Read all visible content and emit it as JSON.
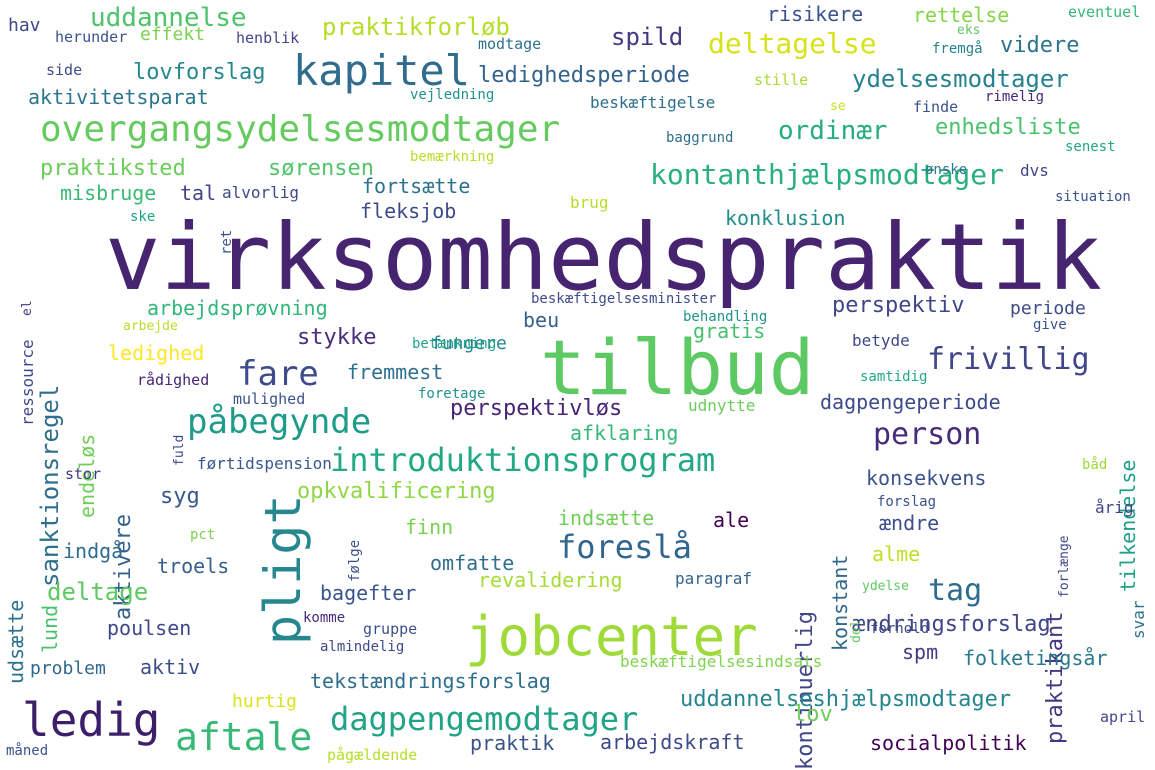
{
  "words": [
    {
      "text": "virksomhedspraktik",
      "color": "#46246f"
    },
    {
      "text": "tilbud",
      "color": "#5dc963"
    },
    {
      "text": "jobcenter",
      "color": "#a0da39"
    },
    {
      "text": "pligt",
      "color": "#26888e"
    },
    {
      "text": "ledig",
      "color": "#3b1f6a"
    },
    {
      "text": "kapitel",
      "color": "#2f6c8e"
    },
    {
      "text": "overgangsydelsesmodtager",
      "color": "#65cb5e"
    },
    {
      "text": "introduktionsprogram",
      "color": "#22a884"
    },
    {
      "text": "aftale",
      "color": "#38b977"
    },
    {
      "text": "påbegynde",
      "color": "#1e9c89"
    },
    {
      "text": "person",
      "color": "#472a7a"
    },
    {
      "text": "foreslå",
      "color": "#31668e"
    },
    {
      "text": "dagpengemodtager",
      "color": "#20a386"
    },
    {
      "text": "fare",
      "color": "#3e4c8a"
    },
    {
      "text": "kontanthjælpsmodtager",
      "color": "#2aaf7f"
    },
    {
      "text": "frivillig",
      "color": "#404688"
    },
    {
      "text": "tag",
      "color": "#2f6b8e"
    },
    {
      "text": "deltagelse",
      "color": "#d8e219"
    },
    {
      "text": "uddannelse",
      "color": "#4ec36b"
    },
    {
      "text": "praktikforløb",
      "color": "#b5de2b"
    },
    {
      "text": "ledighedsperiode",
      "color": "#33628d"
    },
    {
      "text": "ordinær",
      "color": "#27ad81"
    },
    {
      "text": "ydelsesmodtager",
      "color": "#26828e"
    },
    {
      "text": "enhedsliste",
      "color": "#4ac16d"
    },
    {
      "text": "lovforslag",
      "color": "#23898e"
    },
    {
      "text": "aktivitetsparat",
      "color": "#2a768e"
    },
    {
      "text": "praktiksted",
      "color": "#6ccd5a"
    },
    {
      "text": "sørensen",
      "color": "#52c569"
    },
    {
      "text": "misbruge",
      "color": "#3aba76"
    },
    {
      "text": "tal",
      "color": "#414487"
    },
    {
      "text": "spild",
      "color": "#443983"
    },
    {
      "text": "risikere",
      "color": "#3b528b"
    },
    {
      "text": "rettelse",
      "color": "#86d549"
    },
    {
      "text": "videre",
      "color": "#2b748e"
    },
    {
      "text": "fortsætte",
      "color": "#2c728e"
    },
    {
      "text": "fleksjob",
      "color": "#3e4989"
    },
    {
      "text": "konklusion",
      "color": "#228d8d"
    },
    {
      "text": "sanktionsregel",
      "color": "#2e6f8e"
    },
    {
      "text": "arbejdsprøvning",
      "color": "#32b67a"
    },
    {
      "text": "perspektiv",
      "color": "#404688"
    },
    {
      "text": "stykke",
      "color": "#472d7b"
    },
    {
      "text": "beu",
      "color": "#35608d"
    },
    {
      "text": "fungere",
      "color": "#26838f"
    },
    {
      "text": "gratis",
      "color": "#44bf70"
    },
    {
      "text": "ledighed",
      "color": "#fde725"
    },
    {
      "text": "fremmest",
      "color": "#2d708e"
    },
    {
      "text": "perspektivløs",
      "color": "#482475"
    },
    {
      "text": "afklaring",
      "color": "#35b779"
    },
    {
      "text": "dagpengeperiode",
      "color": "#3e4a89"
    },
    {
      "text": "endeløs",
      "color": "#6ece58"
    },
    {
      "text": "aktivere",
      "color": "#34618d"
    },
    {
      "text": "kontinuerlig",
      "color": "#3f4788"
    },
    {
      "text": "konstant",
      "color": "#31688e"
    },
    {
      "text": "praktikant",
      "color": "#453781"
    },
    {
      "text": "tilkendelse",
      "color": "#1fa088"
    },
    {
      "text": "konsekvens",
      "color": "#3b528b"
    },
    {
      "text": "opkvalificering",
      "color": "#8fd744"
    },
    {
      "text": "syg",
      "color": "#38598c"
    },
    {
      "text": "ændre",
      "color": "#3d4e8a"
    },
    {
      "text": "ale",
      "color": "#440154"
    },
    {
      "text": "indsætte",
      "color": "#6ece58"
    },
    {
      "text": "finn",
      "color": "#7ad151"
    },
    {
      "text": "udsætte",
      "color": "#2d718e"
    },
    {
      "text": "indgå",
      "color": "#2f6c8e"
    },
    {
      "text": "troels",
      "color": "#355f8d"
    },
    {
      "text": "omfatte",
      "color": "#2e6e8e"
    },
    {
      "text": "alme",
      "color": "#bddf26"
    },
    {
      "text": "lund",
      "color": "#4ac16d"
    },
    {
      "text": "deltage",
      "color": "#5ec962"
    },
    {
      "text": "revalidering",
      "color": "#a5db36"
    },
    {
      "text": "bagefter",
      "color": "#3a548c"
    },
    {
      "text": "poulsen",
      "color": "#3f4889"
    },
    {
      "text": "paragraf",
      "color": "#33638d"
    },
    {
      "text": "spm",
      "color": "#443983"
    },
    {
      "text": "ændringsforslag",
      "color": "#404588"
    },
    {
      "text": "folketingsår",
      "color": "#2a778e"
    },
    {
      "text": "aktiv",
      "color": "#3d4e8a"
    },
    {
      "text": "problem",
      "color": "#31688e"
    },
    {
      "text": "tekstændringsforslag",
      "color": "#2e6d8e"
    },
    {
      "text": "beskæftigelsesindsats",
      "color": "#7fd34e"
    },
    {
      "text": "uddannelseshjælpsmodtager",
      "color": "#24868e"
    },
    {
      "text": "hurtig",
      "color": "#dde318"
    },
    {
      "text": "lov",
      "color": "#6ccd5a"
    },
    {
      "text": "praktik",
      "color": "#3b528b"
    },
    {
      "text": "arbejdskraft",
      "color": "#3e4989"
    },
    {
      "text": "socialpolitik",
      "color": "#440154"
    },
    {
      "text": "hav",
      "color": "#404688"
    },
    {
      "text": "herunder",
      "color": "#3b528b"
    },
    {
      "text": "effekt",
      "color": "#7ad151"
    },
    {
      "text": "henblik",
      "color": "#414487"
    },
    {
      "text": "modtage",
      "color": "#2c728e"
    },
    {
      "text": "eventuel",
      "color": "#35b779"
    },
    {
      "text": "eks",
      "color": "#5ec962"
    },
    {
      "text": "fremgå",
      "color": "#25848e"
    },
    {
      "text": "side",
      "color": "#3e4a89"
    },
    {
      "text": "stille",
      "color": "#a8db34"
    },
    {
      "text": "vejledning",
      "color": "#21918c"
    },
    {
      "text": "beskæftigelse",
      "color": "#2d708e"
    },
    {
      "text": "se",
      "color": "#c8e020"
    },
    {
      "text": "finde",
      "color": "#3b528b"
    },
    {
      "text": "rimelig",
      "color": "#482878"
    },
    {
      "text": "baggrund",
      "color": "#2e6f8e"
    },
    {
      "text": "bemærkning",
      "color": "#b8de29"
    },
    {
      "text": "ønske",
      "color": "#2a788e"
    },
    {
      "text": "dvs",
      "color": "#404688"
    },
    {
      "text": "senest",
      "color": "#22a884"
    },
    {
      "text": "alvorlig",
      "color": "#3e4989"
    },
    {
      "text": "brug",
      "color": "#b5de2b"
    },
    {
      "text": "ret",
      "color": "#3b528b"
    },
    {
      "text": "ske",
      "color": "#1fa187"
    },
    {
      "text": "situation",
      "color": "#3b528b"
    },
    {
      "text": "ressource",
      "color": "#3e4989"
    },
    {
      "text": "el",
      "color": "#443983"
    },
    {
      "text": "arbejde",
      "color": "#b5de2b"
    },
    {
      "text": "beskæftigelsesminister",
      "color": "#3e4c8a"
    },
    {
      "text": "behandling",
      "color": "#20928c"
    },
    {
      "text": "periode",
      "color": "#3e4a89"
    },
    {
      "text": "give",
      "color": "#3b528b"
    },
    {
      "text": "betænkning",
      "color": "#20a386"
    },
    {
      "text": "betyde",
      "color": "#3f4788"
    },
    {
      "text": "rådighed",
      "color": "#482575"
    },
    {
      "text": "samtidig",
      "color": "#22a884"
    },
    {
      "text": "mulighed",
      "color": "#3b528b"
    },
    {
      "text": "foretage",
      "color": "#21918c"
    },
    {
      "text": "udnytte",
      "color": "#6ccd5a"
    },
    {
      "text": "fuld",
      "color": "#3e4989"
    },
    {
      "text": "førtidspension",
      "color": "#38598c"
    },
    {
      "text": "stor",
      "color": "#443983"
    },
    {
      "text": "båd",
      "color": "#a0da39"
    },
    {
      "text": "forslag",
      "color": "#3b528b"
    },
    {
      "text": "årig",
      "color": "#404688"
    },
    {
      "text": "pct",
      "color": "#7ad151"
    },
    {
      "text": "følge",
      "color": "#3b528b"
    },
    {
      "text": "forlænge",
      "color": "#3e4989"
    },
    {
      "text": "svar",
      "color": "#2c728e"
    },
    {
      "text": "ydelse",
      "color": "#5ec962"
    },
    {
      "text": "forhold",
      "color": "#3e4989"
    },
    {
      "text": "komme",
      "color": "#472d7b"
    },
    {
      "text": "gruppe",
      "color": "#3b528b"
    },
    {
      "text": "del",
      "color": "#5ec962"
    },
    {
      "text": "almindelig",
      "color": "#3e4989"
    },
    {
      "text": "april",
      "color": "#404688"
    },
    {
      "text": "måned",
      "color": "#3b528b"
    },
    {
      "text": "pågældende",
      "color": "#b5de2b"
    }
  ]
}
